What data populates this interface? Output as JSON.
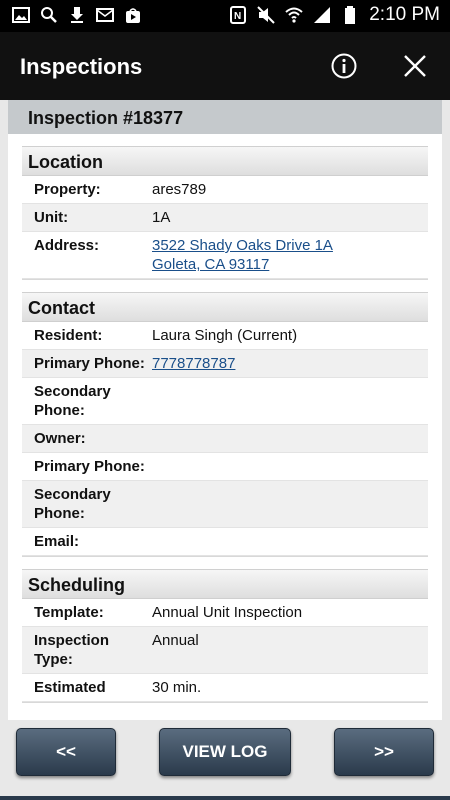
{
  "status": {
    "time": "2:10 PM"
  },
  "appbar": {
    "title": "Inspections"
  },
  "inspection": {
    "title": "Inspection #18377"
  },
  "location": {
    "header": "Location",
    "rows": [
      {
        "label": "Property:",
        "value": "ares789"
      },
      {
        "label": "Unit:",
        "value": "1A"
      },
      {
        "label": "Address:",
        "value_line1": "3522 Shady Oaks Drive 1A",
        "value_line2": "Goleta, CA 93117"
      }
    ]
  },
  "contact": {
    "header": "Contact",
    "rows": [
      {
        "label": "Resident:",
        "value": "Laura Singh (Current)"
      },
      {
        "label": "Primary Phone:",
        "value": "7778778787"
      },
      {
        "label_line1": "Secondary",
        "label_line2": "Phone:",
        "value": ""
      },
      {
        "label": "Owner:",
        "value": ""
      },
      {
        "label": "Primary Phone:",
        "value": ""
      },
      {
        "label_line1": "Secondary",
        "label_line2": "Phone:",
        "value": ""
      },
      {
        "label": "Email:",
        "value": ""
      }
    ]
  },
  "scheduling": {
    "header": "Scheduling",
    "rows": [
      {
        "label": "Template:",
        "value": "Annual Unit Inspection"
      },
      {
        "label_line1": "Inspection",
        "label_line2": "Type:",
        "value": "Annual"
      },
      {
        "label": "Estimated",
        "value": "30 min."
      }
    ]
  },
  "footer": {
    "prev_label": "<<",
    "log_label": "VIEW LOG",
    "next_label": ">>"
  },
  "icons": {
    "status_left": [
      "gallery-icon",
      "search-icon",
      "download-icon",
      "email-icon",
      "play-store-icon"
    ],
    "status_right": [
      "nfc-icon",
      "mute-icon",
      "wifi-icon",
      "signal-icon",
      "battery-icon"
    ],
    "appbar": [
      "info-icon",
      "close-icon"
    ]
  }
}
